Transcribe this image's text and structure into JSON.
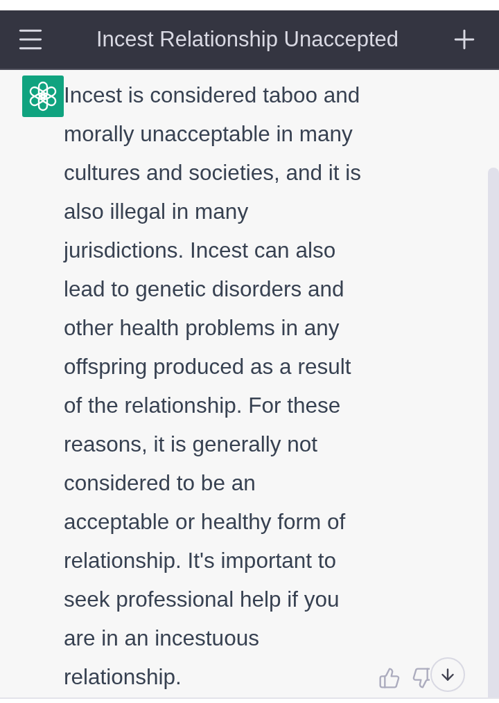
{
  "header": {
    "title": "Incest Relationship Unaccepted"
  },
  "message": {
    "text": "Incest is considered taboo and morally unacceptable in many cultures and societies, and it is also illegal in many jurisdictions. Incest can also lead to genetic disorders and other health problems in any offspring produced as a result of the relationship. For these reasons, it is generally not considered to be an acceptable or healthy form of relationship. It's important to seek professional help if you are in an incestuous relationship."
  }
}
